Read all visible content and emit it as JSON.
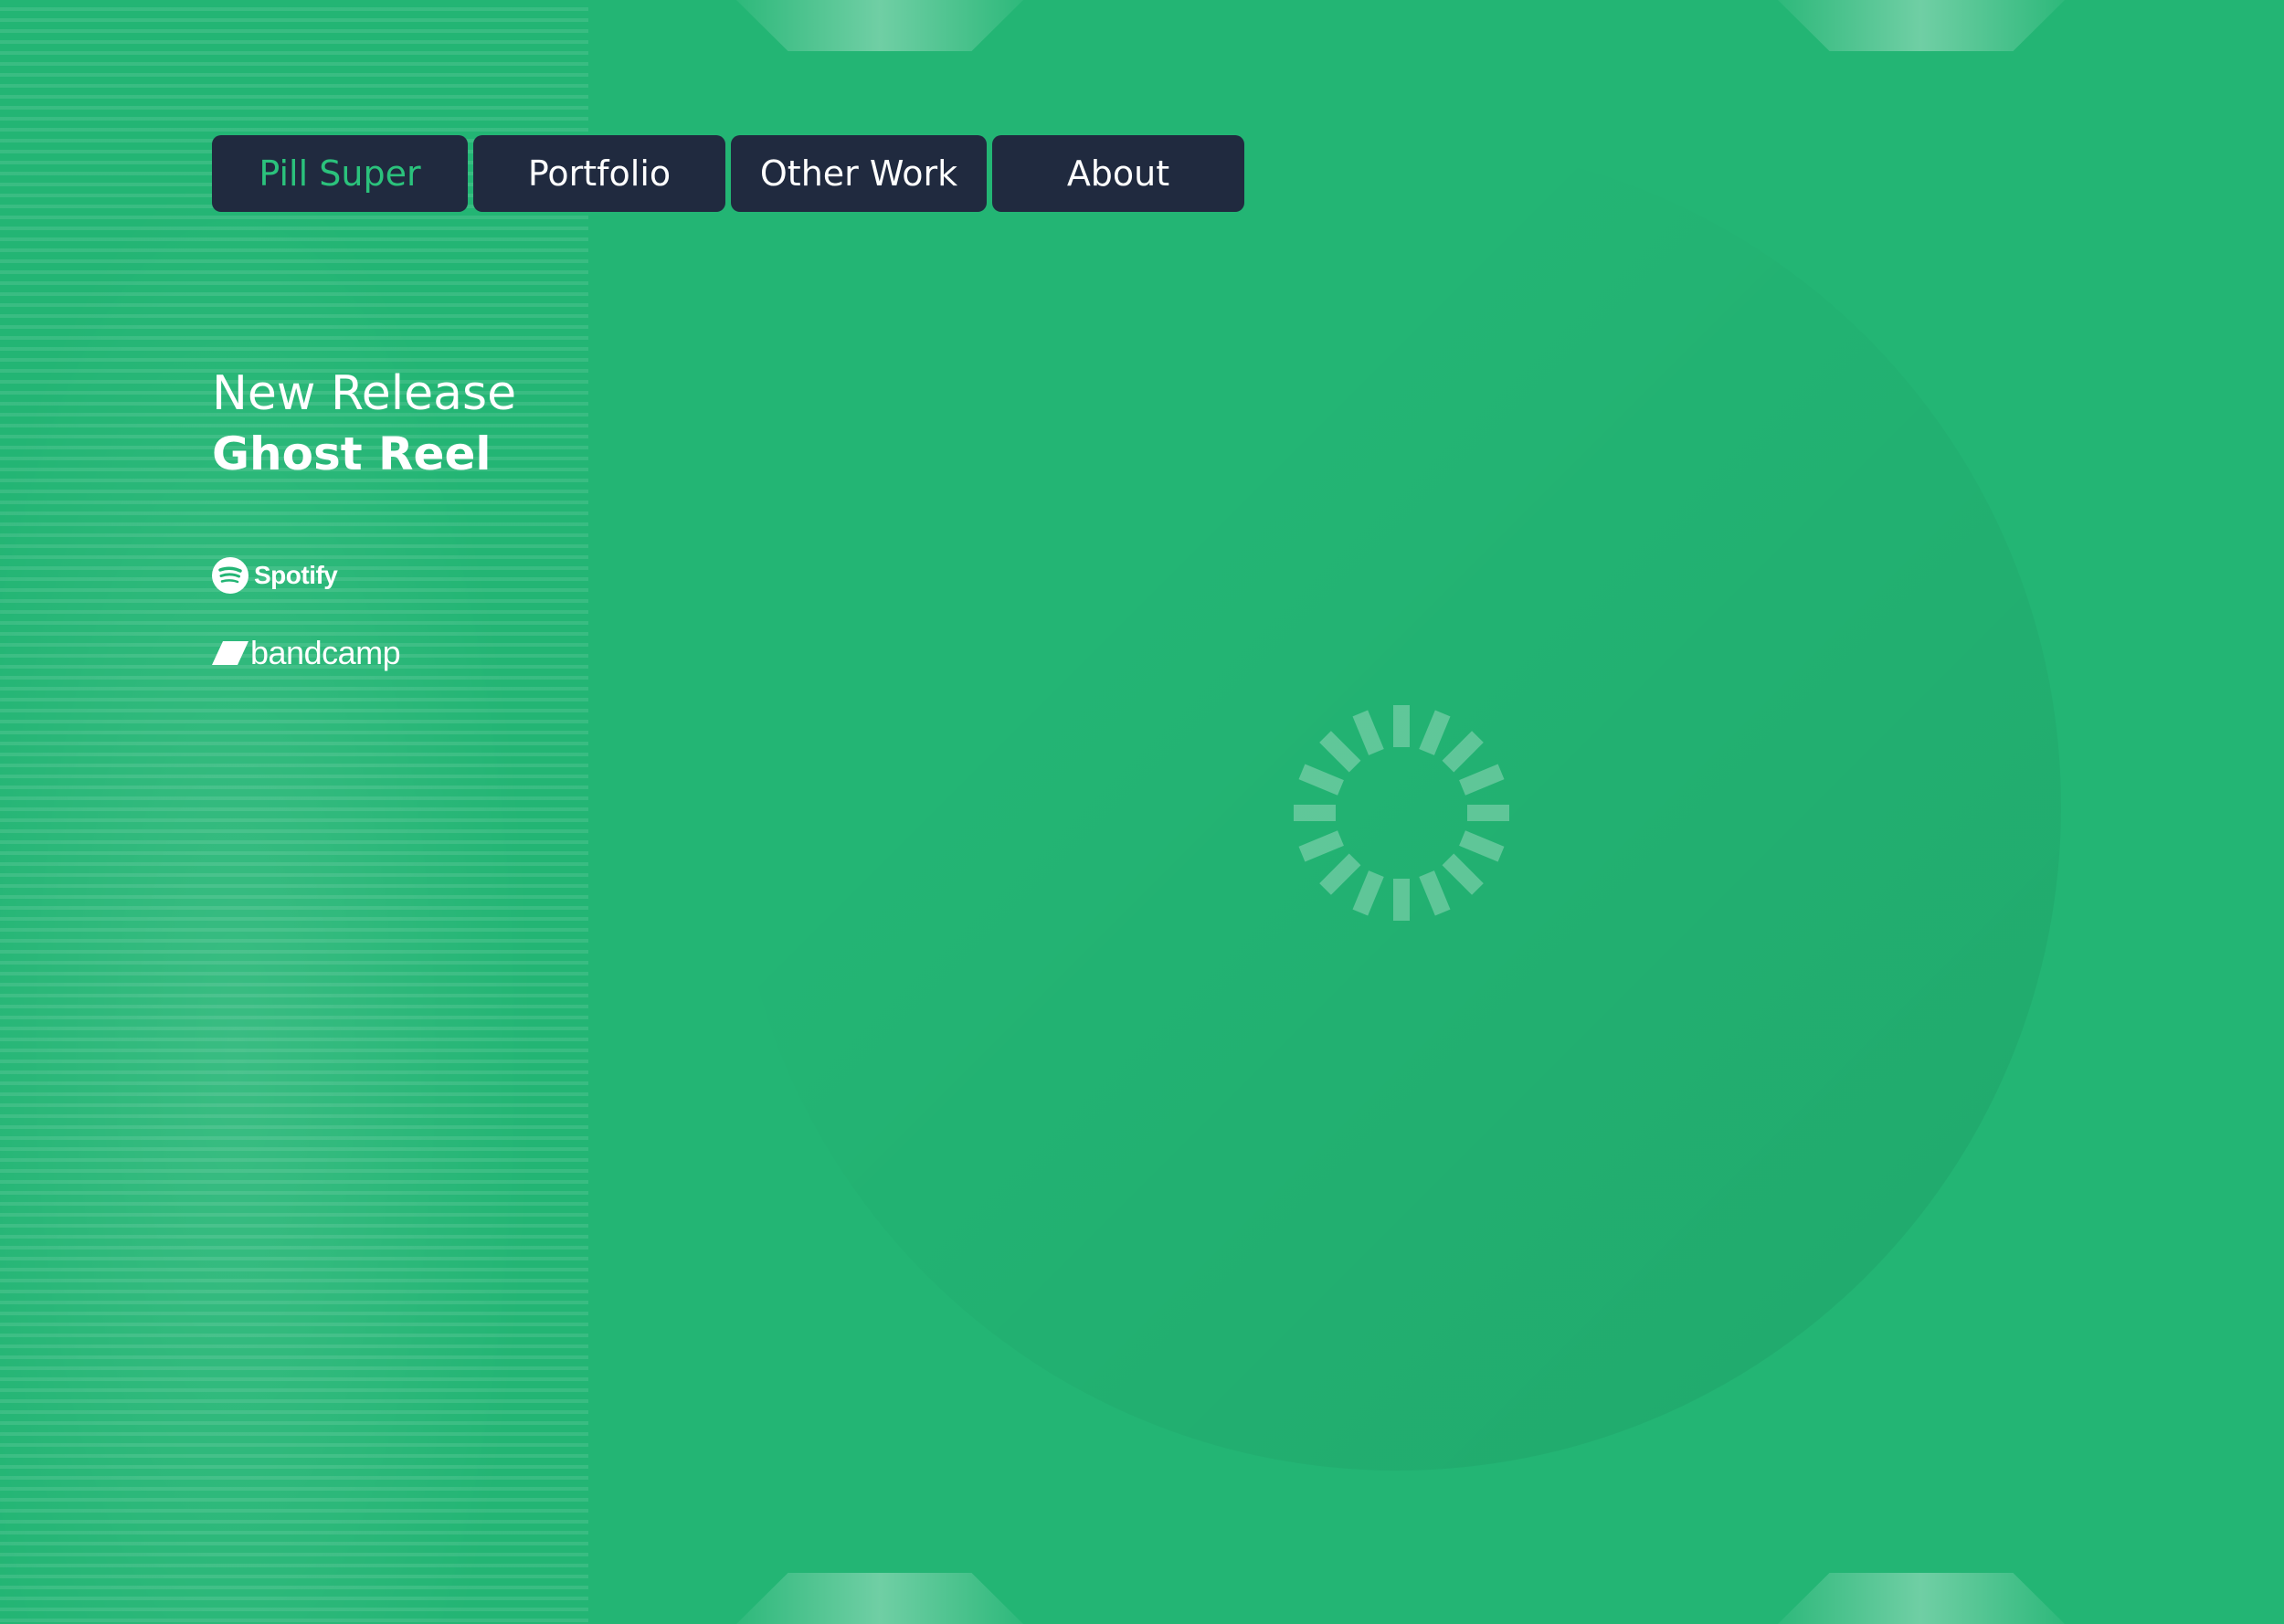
{
  "nav": {
    "items": [
      {
        "label": "Pill Super",
        "active": true
      },
      {
        "label": "Portfolio",
        "active": false
      },
      {
        "label": "Other Work",
        "active": false
      },
      {
        "label": "About",
        "active": false
      }
    ]
  },
  "release": {
    "label": "New Release",
    "title": "Ghost Reel"
  },
  "links": {
    "spotify": "Spotify",
    "bandcamp": "bandcamp"
  },
  "colors": {
    "background": "#23b574",
    "nav_bg": "#202a3f",
    "nav_active_text": "#2bc27c",
    "text": "#ffffff"
  },
  "icons": {
    "spotify": "spotify-icon",
    "bandcamp": "bandcamp-icon",
    "loading": "loading-spinner-icon"
  }
}
